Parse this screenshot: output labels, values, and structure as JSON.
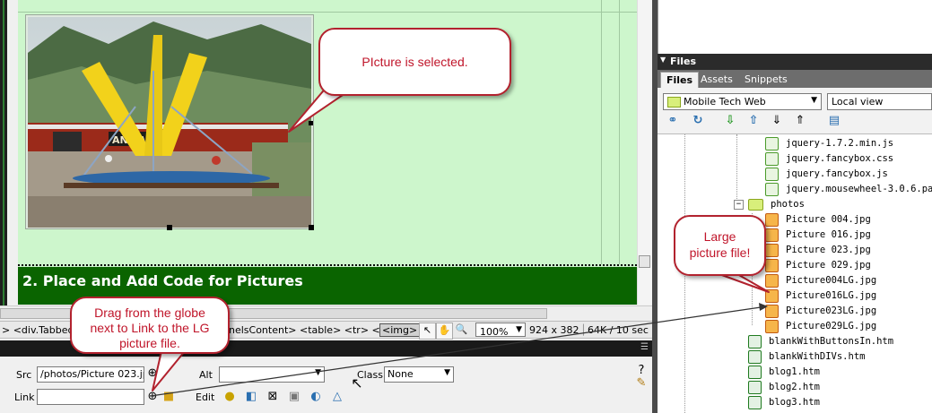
{
  "document": {
    "heading": "2. Place and Add Code for Pictures",
    "photo_sign": "AN EAGLE"
  },
  "callouts": {
    "picture_selected": "PIcture is selected.",
    "drag_globe": "Drag from the globe next to Link to the LG picture file.",
    "large_file": "Large picture file!"
  },
  "statusbar": {
    "tags_left": "> <div.TabbedP",
    "tags_right": "nelsContent> <table> <tr> <td>",
    "tag_selected": "<img>",
    "zoom": "100%",
    "dimensions": "924 x 382",
    "size_time": "64K / 10 sec"
  },
  "properties": {
    "src_label": "Src",
    "src_value": "/photos/Picture 023.jpg",
    "link_label": "Link",
    "link_value": "",
    "alt_label": "Alt",
    "alt_value": "",
    "class_label": "Class",
    "class_value": "None",
    "edit_label": "Edit"
  },
  "files_panel": {
    "title": "Files",
    "tabs": [
      "Files",
      "Assets",
      "Snippets"
    ],
    "site": "Mobile Tech Web",
    "view": "Local view",
    "items": [
      {
        "name": "jquery-1.7.2.min.js",
        "type": "js"
      },
      {
        "name": "jquery.fancybox.css",
        "type": "js"
      },
      {
        "name": "jquery.fancybox.js",
        "type": "js"
      },
      {
        "name": "jquery.mousewheel-3.0.6.pack.js",
        "type": "js"
      },
      {
        "name": "photos",
        "type": "folder"
      },
      {
        "name": "Picture 004.jpg",
        "type": "img"
      },
      {
        "name": "Picture 016.jpg",
        "type": "img"
      },
      {
        "name": "Picture 023.jpg",
        "type": "img"
      },
      {
        "name": "Picture 029.jpg",
        "type": "img"
      },
      {
        "name": "Picture004LG.jpg",
        "type": "img"
      },
      {
        "name": "Picture016LG.jpg",
        "type": "img"
      },
      {
        "name": "Picture023LG.jpg",
        "type": "img"
      },
      {
        "name": "Picture029LG.jpg",
        "type": "img"
      },
      {
        "name": "blankWithButtonsIn.htm",
        "type": "htm"
      },
      {
        "name": "blankWithDIVs.htm",
        "type": "htm"
      },
      {
        "name": "blog1.htm",
        "type": "htm"
      },
      {
        "name": "blog2.htm",
        "type": "htm"
      },
      {
        "name": "blog3.htm",
        "type": "htm"
      }
    ]
  }
}
